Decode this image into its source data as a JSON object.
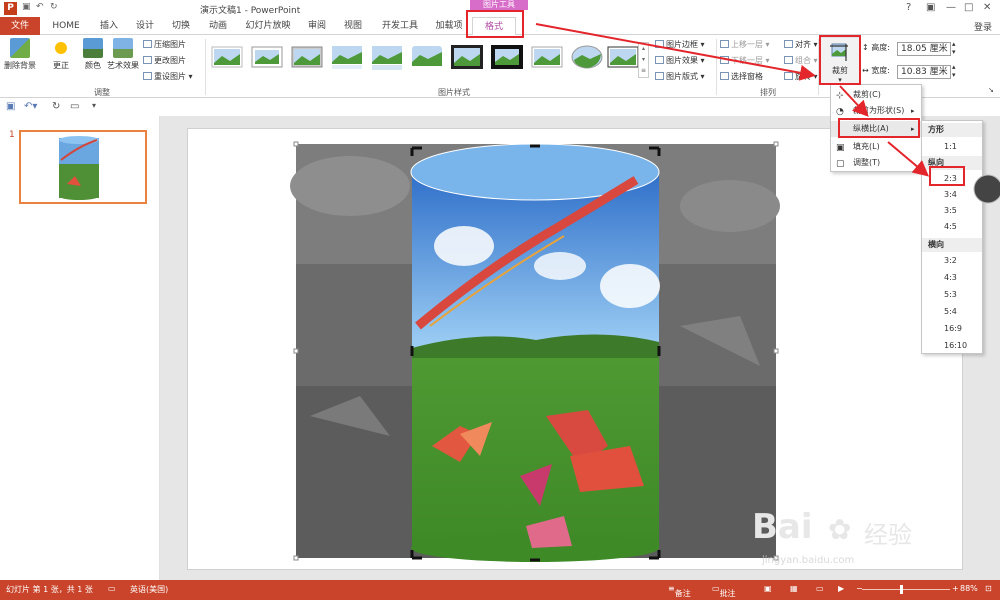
{
  "title_bar": {
    "app_icon": "P",
    "window_title": "演示文稿1 - PowerPoint",
    "context_tab_group": "图片工具",
    "help_icon": "?",
    "minimize": "—",
    "restore": "□",
    "close": "✕",
    "login_label": "登录"
  },
  "tabs": [
    {
      "label": "文件"
    },
    {
      "label": "HOME"
    },
    {
      "label": "插入"
    },
    {
      "label": "设计"
    },
    {
      "label": "切换"
    },
    {
      "label": "动画"
    },
    {
      "label": "幻灯片放映"
    },
    {
      "label": "审阅"
    },
    {
      "label": "视图"
    },
    {
      "label": "开发工具"
    },
    {
      "label": "加载项"
    },
    {
      "label": "格式"
    }
  ],
  "ribbon": {
    "remove_bg_label": "删除背景",
    "corrections_label": "更正",
    "color_label": "颜色",
    "artistic_label": "艺术效果",
    "compress_label": "压缩图片",
    "change_picture_label": "更改图片",
    "reset_picture_label": "重设图片",
    "adjust_group_label": "调整",
    "picture_styles_group_label": "图片样式",
    "border_label": "图片边框",
    "effects_label": "图片效果",
    "layout_label": "图片版式",
    "bring_forward_label": "上移一层",
    "send_backward_label": "下移一层",
    "selection_pane_label": "选择窗格",
    "align_label": "对齐",
    "group_label": "组合",
    "rotate_label": "旋转",
    "arrange_group_label": "排列",
    "crop_label": "裁剪",
    "height_label": "高度:",
    "height_value": "18.05 厘米",
    "width_label": "宽度:",
    "width_value": "10.83 厘米"
  },
  "crop_menu": {
    "items": [
      {
        "label": "裁剪(C)"
      },
      {
        "label": "裁剪为形状(S)"
      },
      {
        "label": "纵横比(A)"
      },
      {
        "label": "填充(L)"
      },
      {
        "label": "调整(T)"
      }
    ]
  },
  "aspect_menu": {
    "square_header": "方形",
    "square_items": [
      "1:1"
    ],
    "portrait_header": "纵向",
    "portrait_items": [
      "2:3",
      "3:4",
      "3:5",
      "4:5"
    ],
    "landscape_header": "横向",
    "landscape_items": [
      "3:2",
      "4:3",
      "5:3",
      "5:4",
      "16:9",
      "16:10"
    ]
  },
  "slide_pane": {
    "thumb_number": "1"
  },
  "status_bar": {
    "slide_info": "幻灯片 第 1 张，共 1 张",
    "language": "英语(美国)",
    "notes_label": "备注",
    "comments_label": "批注",
    "zoom_minus": "−",
    "zoom_plus": "+",
    "zoom_level": "88%"
  },
  "watermark": {
    "brand": "Bai",
    "brand_cn": "经验",
    "url": "jingyan.baidu.com"
  },
  "colors": {
    "accent": "#c9442a",
    "format_tab": "#b24aa3",
    "highlight_box": "#e3262c"
  }
}
